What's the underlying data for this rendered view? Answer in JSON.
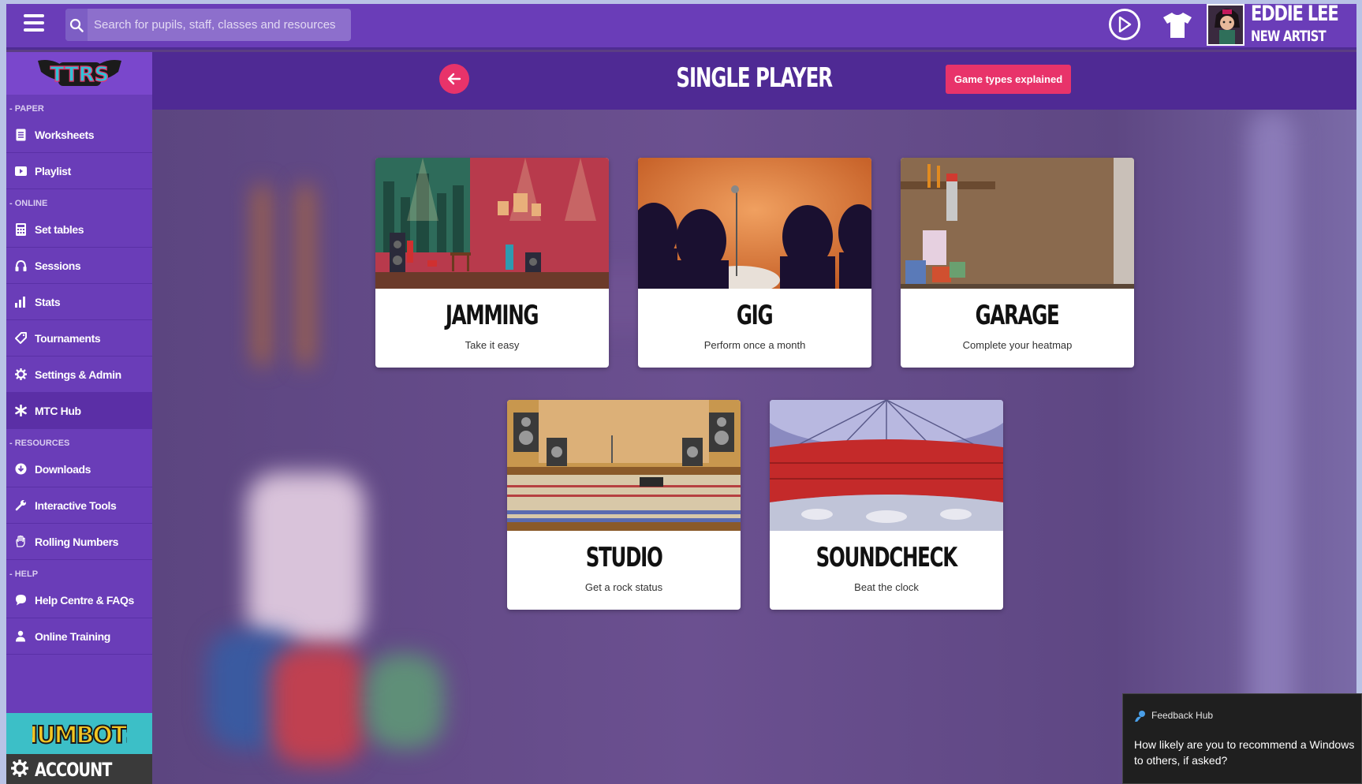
{
  "search": {
    "placeholder": "Search for pupils, staff, classes and resources"
  },
  "user": {
    "name": "EDDIE LEE",
    "rank": "NEW ARTIST"
  },
  "brand": {
    "logo": "TTRS",
    "accent": "#e8336a",
    "primary": "#6a3db8"
  },
  "sidebar": {
    "sections": [
      {
        "label": "- PAPER",
        "items": [
          {
            "label": "Worksheets",
            "icon": "document-icon"
          },
          {
            "label": "Playlist",
            "icon": "play-icon"
          }
        ]
      },
      {
        "label": "- ONLINE",
        "items": [
          {
            "label": "Set tables",
            "icon": "calculator-icon"
          },
          {
            "label": "Sessions",
            "icon": "headphones-icon"
          },
          {
            "label": "Stats",
            "icon": "bar-chart-icon"
          },
          {
            "label": "Tournaments",
            "icon": "tag-icon"
          },
          {
            "label": "Settings & Admin",
            "icon": "gear-icon"
          },
          {
            "label": "MTC Hub",
            "icon": "asterisk-icon"
          }
        ]
      },
      {
        "label": "- RESOURCES",
        "items": [
          {
            "label": "Downloads",
            "icon": "download-icon"
          },
          {
            "label": "Interactive Tools",
            "icon": "wrench-icon"
          },
          {
            "label": "Rolling Numbers",
            "icon": "hand-icon"
          }
        ]
      },
      {
        "label": "- HELP",
        "items": [
          {
            "label": "Help Centre & FAQs",
            "icon": "chat-bubble-icon"
          },
          {
            "label": "Online Training",
            "icon": "person-icon"
          }
        ]
      }
    ],
    "numbots": "NUMBOTS",
    "account": "ACCOUNT"
  },
  "header": {
    "title": "SINGLE PLAYER",
    "types_button": "Game types explained"
  },
  "games": [
    {
      "name": "JAMMING",
      "desc": "Take it easy"
    },
    {
      "name": "GIG",
      "desc": "Perform once a month"
    },
    {
      "name": "GARAGE",
      "desc": "Complete your heatmap"
    },
    {
      "name": "STUDIO",
      "desc": "Get a rock status"
    },
    {
      "name": "SOUNDCHECK",
      "desc": "Beat the clock"
    }
  ],
  "toast": {
    "app": "Feedback Hub",
    "line1": "How likely are you to recommend a Windows",
    "line2": "to others, if asked?"
  }
}
